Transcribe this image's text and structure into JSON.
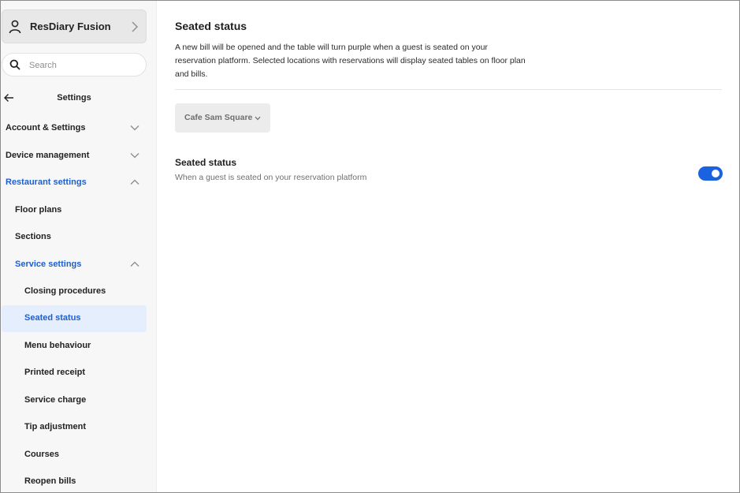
{
  "account": {
    "name": "ResDiary Fusion",
    "icon": "person-icon"
  },
  "search": {
    "placeholder": "Search"
  },
  "sidebar": {
    "header": "Settings",
    "items": [
      {
        "label": "Account & Settings",
        "expanded": false
      },
      {
        "label": "Device management",
        "expanded": false
      },
      {
        "label": "Restaurant settings",
        "expanded": true
      },
      {
        "label": "Floor plans"
      },
      {
        "label": "Sections"
      },
      {
        "label": "Service settings",
        "expanded": true
      },
      {
        "label": "Closing procedures"
      },
      {
        "label": "Seated status",
        "selected": true
      },
      {
        "label": "Menu behaviour"
      },
      {
        "label": "Printed receipt"
      },
      {
        "label": "Service charge"
      },
      {
        "label": "Tip adjustment"
      },
      {
        "label": "Courses"
      },
      {
        "label": "Reopen bills"
      }
    ]
  },
  "main": {
    "title": "Seated status",
    "description": "A new bill will be opened and the table will turn purple when a guest is seated on your reservation platform. Selected locations with reservations will display seated tables on floor plan and bills.",
    "location_select": "Cafe Sam Square",
    "setting": {
      "title": "Seated status",
      "subtitle": "When a guest is seated on your reservation platform",
      "enabled": true
    }
  },
  "colors": {
    "accent": "#1c5fd1",
    "toggle_on": "#1a62e0",
    "active_bg": "#e4eefc",
    "sidebar_bg": "#f7f7f7"
  }
}
